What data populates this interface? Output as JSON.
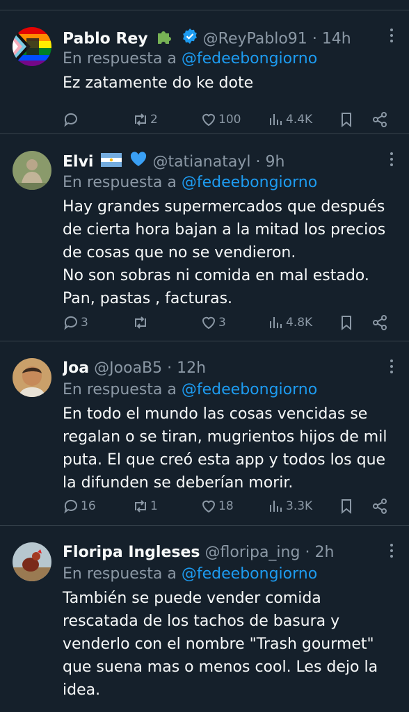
{
  "tweets": [
    {
      "name": "Pablo Rey",
      "handle": "@ReyPablo91",
      "time": "14h",
      "reply_prefix": "En respuesta a",
      "reply_to": "@fedeebongiorno",
      "text": "Ez zatamente do ke dote",
      "replies": "",
      "retweets": "2",
      "likes": "100",
      "views": "4.4K",
      "badges": [
        "puzzle-icon",
        "verified-icon"
      ]
    },
    {
      "name": "Elvi",
      "handle": "@tatianatayl",
      "time": "9h",
      "reply_prefix": "En respuesta a",
      "reply_to": "@fedeebongiorno",
      "text": "Hay grandes supermercados que después\nde cierta hora bajan a la mitad los precios\nde cosas que no se vendieron.\nNo son sobras ni comida en mal estado.\nPan, pastas , facturas.",
      "replies": "3",
      "retweets": "",
      "likes": "3",
      "views": "4.8K",
      "badges": [
        "argentina-flag-icon",
        "blue-heart-icon"
      ]
    },
    {
      "name": "Joa",
      "handle": "@JooaB5",
      "time": "12h",
      "reply_prefix": "En respuesta a",
      "reply_to": "@fedeebongiorno",
      "text": "En todo el mundo las cosas vencidas se\nregalan o se tiran, mugrientos hijos de mil\nputa. El que creó esta app y todos los que\nla difunden se deberían morir.",
      "replies": "16",
      "retweets": "1",
      "likes": "18",
      "views": "3.3K",
      "badges": []
    },
    {
      "name": "Floripa Ingleses",
      "handle": "@floripa_ing",
      "time": "2h",
      "reply_prefix": "En respuesta a",
      "reply_to": "@fedeebongiorno",
      "text": "También se puede vender comida\nrescatada de los tachos de basura y\nvenderlo con el nombre \"Trash gourmet\"\nque suena mas o menos cool. Les dejo la\nidea.",
      "replies": "",
      "retweets": "",
      "likes": "",
      "views": "",
      "badges": []
    }
  ],
  "separator": "·",
  "colors": {
    "background": "#15202b",
    "secondary": "#8b98a5",
    "mention": "#1d9bf0",
    "divider": "#38444d"
  }
}
